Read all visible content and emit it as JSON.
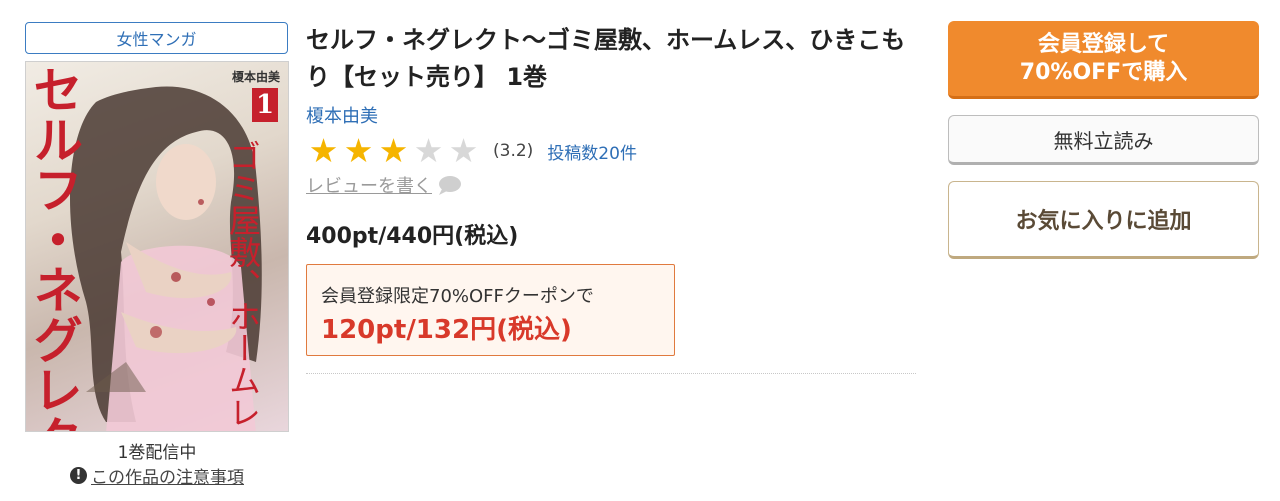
{
  "genre": "女性マンガ",
  "cover": {
    "title_vertical": "セルフ・ネグレクト",
    "subtitle_vertical": "ゴミ屋敷、ホームレス、ひきこもり",
    "author": "榎本由美",
    "volume": "1",
    "accent_color": "#c6202c"
  },
  "delivery_status": "1巻配信中",
  "notice": {
    "icon": "exclamation-icon",
    "label": "この作品の注意事項"
  },
  "book": {
    "title": "セルフ・ネグレクト〜ゴミ屋敷、ホームレス、ひきこもり【セット売り】 1巻",
    "author": "榎本由美"
  },
  "rating": {
    "stars_filled": 3,
    "stars_total": 5,
    "value_text": "(3.2)",
    "review_count": "投稿数20件",
    "write_review": "レビューを書く",
    "write_review_icon": "speech-bubble-icon"
  },
  "price": "400pt/440円(税込)",
  "coupon": {
    "label": "会員登録限定70%OFFクーポンで",
    "price": "120pt/132円(税込)",
    "accent_color": "#d8392a"
  },
  "actions": {
    "buy_line1": "会員登録して",
    "buy_line2": "70%OFFで購入",
    "preview": "無料立読み",
    "favorite": "お気に入りに追加"
  },
  "colors": {
    "link": "#2f6fb6",
    "buy_button": "#f08a2d",
    "star_on": "#f5b400",
    "star_off": "#d8d8d8"
  }
}
